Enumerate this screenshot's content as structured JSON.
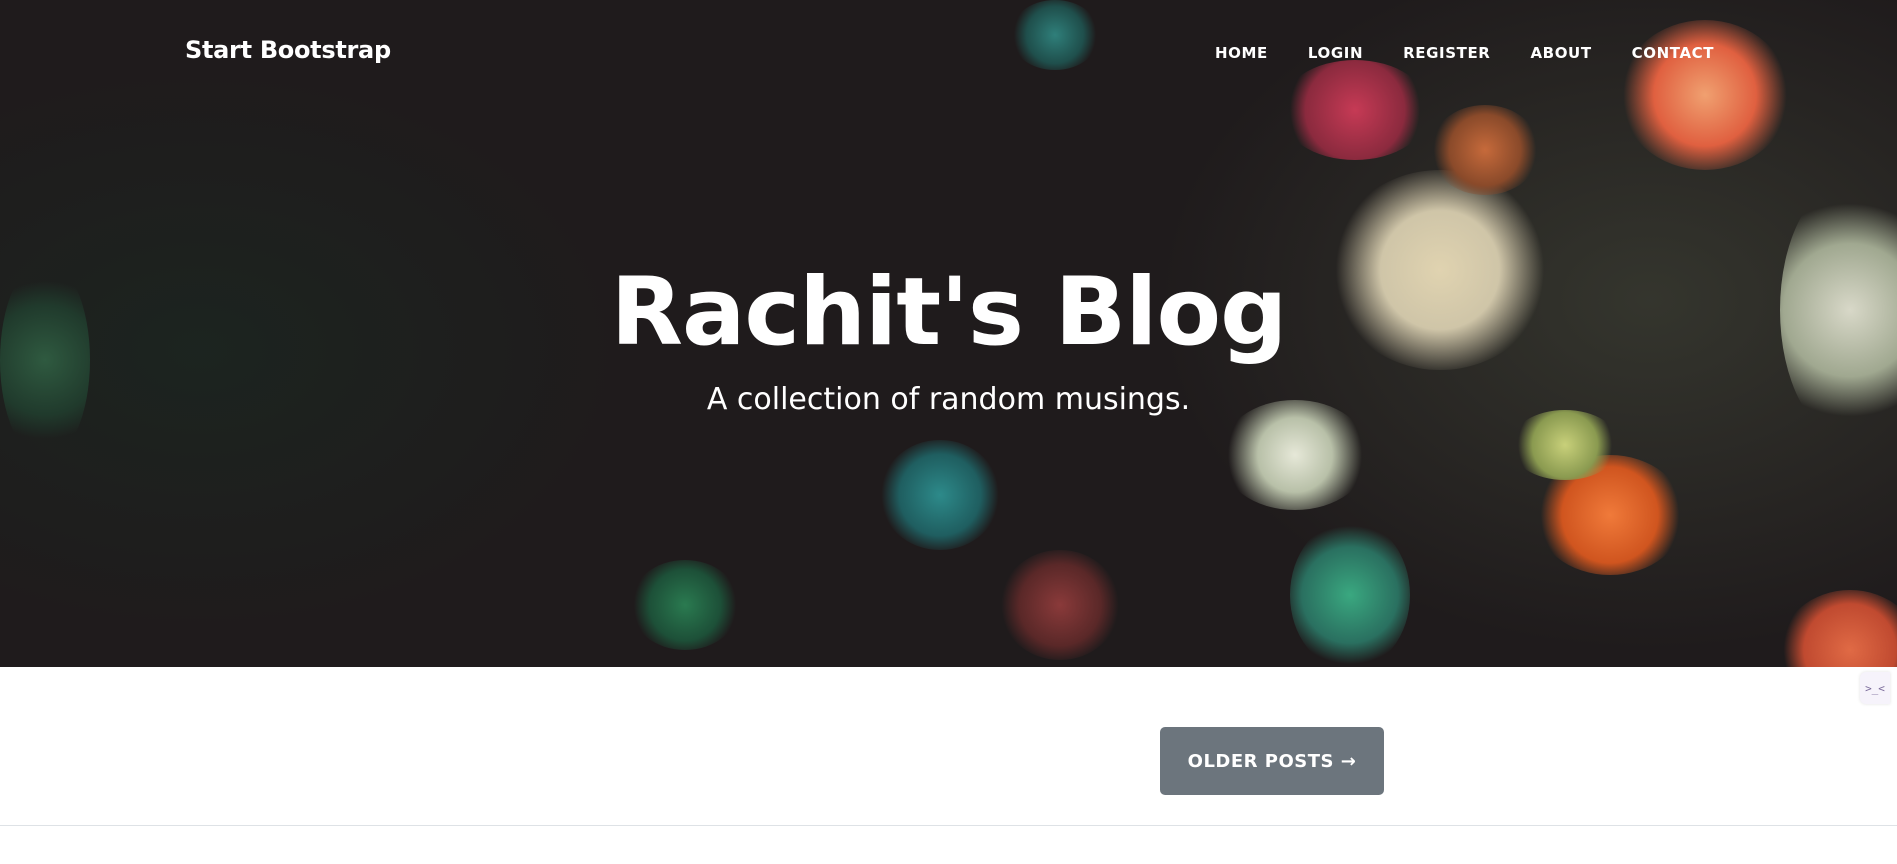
{
  "navbar": {
    "brand": "Start Bootstrap",
    "links": [
      "HOME",
      "LOGIN",
      "REGISTER",
      "ABOUT",
      "CONTACT"
    ]
  },
  "hero": {
    "title": "Rachit's Blog",
    "subtitle": "A collection of random musings."
  },
  "pager": {
    "older_label": "OLDER POSTS →"
  },
  "side_widget": {
    "icon": "terminal-face-icon",
    "glyph": ">_<"
  },
  "colors": {
    "hero_overlay": "#1f1b1c",
    "button_bg": "#6c757d",
    "text_light": "#ffffff"
  }
}
